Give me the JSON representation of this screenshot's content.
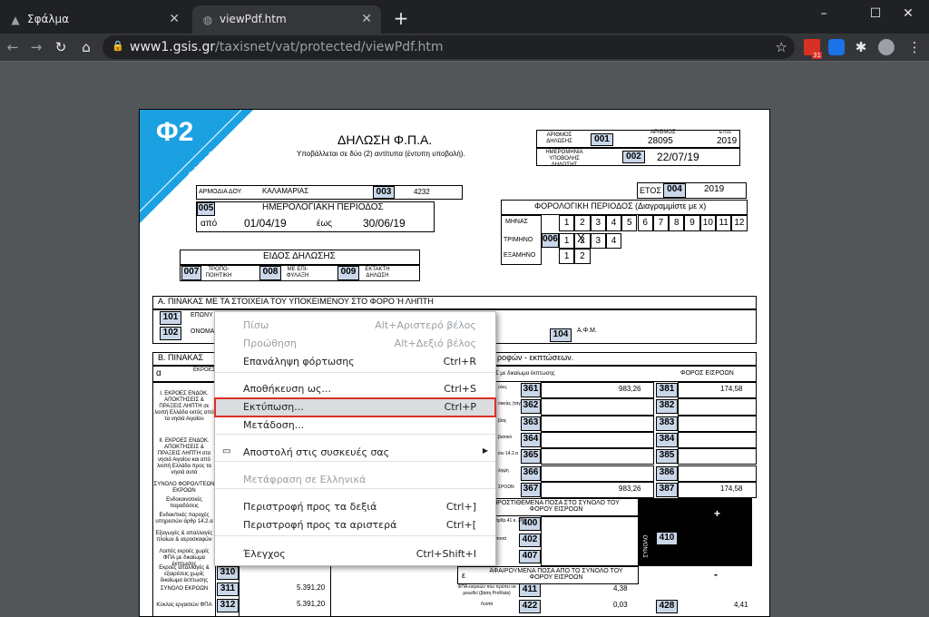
{
  "tabs": [
    {
      "title": "Σφάλμα",
      "active": false
    },
    {
      "title": "viewPdf.htm",
      "active": true
    }
  ],
  "window": {
    "minimize": "–",
    "maximize": "☐",
    "close": "✕"
  },
  "toolbar": {
    "url_host": "www1.gsis.gr",
    "url_path": "/taxisnet/vat/protected/viewPdf.htm"
  },
  "extensions": [
    "calendar-31",
    "cloud-extension",
    "puzzle-extensions",
    "profile-avatar"
  ],
  "colors": {
    "accent_blue": "#1ba1e2",
    "highlight_red": "#d93025",
    "code_fill": "#c9d7e8"
  },
  "form": {
    "logo": "Φ2",
    "logo_side": "TAXIS",
    "title": "ΔΗΛΩΣΗ Φ.Π.Α.",
    "subtitle": "Υποβάλλεται σε δύο (2) αντίτυπα (έντυπη υποβολή).",
    "arithmos_label": "ΑΡΙΘΜΟΣ ΔΗΛΩΣΗΣ",
    "code_001": "001",
    "arithmos_small": "ΑΡΙΘΜΟΣ",
    "arithmos_value": "28095",
    "etos_small": "ΕΤΟΣ",
    "arithmos_year": "2019",
    "hmerominia_label": "ΗΜΕΡΟΜΗΝΙΑ ΥΠΟΒΟΛΗΣ ΔΗΛΩΣΗΣ",
    "code_002": "002",
    "hmerominia_value": "22/07/19",
    "armodia_label": "ΑΡΜΟΔΙΑ ΔΟΥ",
    "armodia_value": "ΚΑΛΑΜΑΡΙΑΣ",
    "code_003": "003",
    "doy_code": "4232",
    "etos_label": "ΕΤΟΣ",
    "code_004": "004",
    "etos_value": "2019",
    "code_005": "005",
    "hmer_period_label": "ΗΜΕΡΟΛΟΓΙΑΚΗ ΠΕΡΙΟΔΟΣ",
    "apo_label": "από",
    "apo_value": "01/04/19",
    "eos_label": "έως",
    "eos_value": "30/06/19",
    "foro_period_label": "ΦΟΡΟΛΟΓΙΚΗ ΠΕΡΙΟΔΟΣ (Διαγραμμίστε με x)",
    "minas_label": "ΜΗΝΑΣ",
    "months": [
      "1",
      "2",
      "3",
      "4",
      "5",
      "6",
      "7",
      "8",
      "9",
      "10",
      "11",
      "12"
    ],
    "trimino_label": "ΤΡΙΜΗΝΟ",
    "code_006": "006",
    "quarters": [
      "1",
      "2",
      "3",
      "4"
    ],
    "quarter_mark": "X",
    "examino_label": "ΕΞΑΜΗΝΟ",
    "halves": [
      "1",
      "2"
    ],
    "eidos_label": "ΕΙΔΟΣ ΔΗΛΩΣΗΣ",
    "code_007": "007",
    "tropo_label": "ΤΡΟΠΟ- ΠΟΙΗΤΙΚΗ",
    "code_008": "008",
    "me_epi_label": "ΜΕ ΕΠΙ- ΦΥΛΑΞΗ",
    "code_009": "009",
    "ektakti_label": "ΕΚΤΑΚΤΗ ΔΗΛΩΣΗ",
    "section_a": "Α. ΠΙΝΑΚΑΣ ΜΕ ΤΑ ΣΤΟΙΧΕΙΑ ΤΟΥ ΥΠΟΚΕΙΜΕΝΟΥ ΣΤΟ ΦΟΡΟ Ή ΛΗΠΤΗ",
    "code_101": "101",
    "eponymo": "ΕΠΩΝΥ",
    "code_102": "102",
    "onoma": "ΟΝΟΜΑ",
    "code_104": "104",
    "afm_label": "Α.Φ.Μ.",
    "section_b": "Β. ΠΙΝΑΚΑΣ",
    "section_b_tail": "ροφών - εκπτώσεων.",
    "alpha": "α",
    "ekroes_header": "ΕΚΡΟΕΣ φορ υπηρεσιών κλπ",
    "ekroes_dik_header": "ΕΣ με δικαίωμα έκπτωσης",
    "foros_eisroon": "ΦΟΡΟΣ ΕΙΣΡΟΩΝ",
    "row_labels_left": [
      "I. ΕΚΡΟΕΣ ΕΝΔΟΚ. ΑΠΟΚΤΗΣΕΙΣ & ΠΡΑΞΕΙΣ ΛΗΠΤΗ σε λοιπή Ελλάδα εκτός από τα νησιά Αιγαίου",
      "II. ΕΚΡΟΕΣ ΕΝΔΟΚ. ΑΠΟΚΤΗΣΕΙΣ & ΠΡΑΞΕΙΣ ΛΗΠΤΗ στα νησιά Αιγαίου και από λοιπή Ελλάδα προς τα νησιά αυτά",
      "ΣΥΝΟΛΟ ΦΟΡΟΛ/ΤΕΩΝ ΕΚΡΟΩΝ",
      "Ενδοκοινοτικές παραδόσεις",
      "Ενδοκ/τικές παροχές υπηρεσιών άρθρ 14.2.α",
      "Εξαγωγές & απαλλαγές πλοίων & αεροσκαφών",
      "Λοιπές εκροές χωρίς ΦΠΑ με δικαίωμα έκπτωσης",
      "Εκροές απαλλαγές & εξαιρέσεις χωρίς δικαίωμα έκπτωσης",
      "ΣΥΝΟΛΟ ΕΚΡΟΩΝ",
      "Κύκλος εργασιών ΦΠΑ"
    ],
    "mid_labels": [
      "ύλες",
      "οικείες (ταγεί)",
      "βίας",
      "βιατικό",
      "ιου 14.2.α",
      "ληψη",
      "ΣΡΟΩΝ"
    ],
    "codes_mid": [
      "361",
      "362",
      "363",
      "364",
      "365",
      "366",
      "367"
    ],
    "mid_values": [
      "983,26",
      "",
      "",
      "",
      "",
      "",
      "983,26"
    ],
    "codes_right": [
      "381",
      "382",
      "383",
      "384",
      "385",
      "386",
      "387"
    ],
    "right_values": [
      "174,58",
      "",
      "",
      "",
      "",
      "",
      "174,58"
    ],
    "prostithemena": "ΠΡΟΣΤΙΘΕΜΕΝΑ ΠΟΣΑ ΣΤΟ ΣΥΝΟΛΟ ΤΟΥ ΦΟΡΟΥ ΕΙΣΡΟΩΝ",
    "codes_plus": [
      "400",
      "402",
      "407"
    ],
    "plus_labels": [
      "άρθρ.41 κ. 3%)",
      "ποσά",
      ""
    ],
    "code_410": "410",
    "synolo_side": "ΣΥΝΟΛΟ",
    "plus_sign": "+",
    "minus_sign": "-",
    "epsilon": "ε",
    "afairoumena": "ΑΦΑΙΡΟΥΜΕΝΑ ΠΟΣΑ ΑΠΟ ΤΟ ΣΥΝΟΛΟ ΤΟΥ ΦΟΡΟΥ ΕΙΣΡΟΩΝ",
    "code_411": "411",
    "code_411_label": "ΦΠΑ εισροών που πρέπει να μειωθεί (βάση ProRata)",
    "code_411_value": "4,38",
    "code_422": "422",
    "code_422_label": "Λοιπά",
    "code_422_value": "0,03",
    "code_428": "428",
    "code_428_value": "4,41",
    "codes_left": [
      "310",
      "311",
      "312"
    ],
    "left_values": [
      "",
      "5.391,20",
      "5.391,20"
    ]
  },
  "context_menu": {
    "items": [
      {
        "label": "Πίσω",
        "shortcut": "Alt+Αριστερό βέλος",
        "disabled": true
      },
      {
        "label": "Προώθηση",
        "shortcut": "Alt+Δεξιό βέλος",
        "disabled": true
      },
      {
        "label": "Επανάληψη φόρτωσης",
        "shortcut": "Ctrl+R",
        "disabled": false
      },
      {
        "label": "Αποθήκευση ως...",
        "shortcut": "Ctrl+S",
        "disabled": false
      },
      {
        "label": "Εκτύπωση...",
        "shortcut": "Ctrl+P",
        "disabled": false,
        "highlighted": true
      },
      {
        "label": "Μετάδοση...",
        "shortcut": "",
        "disabled": false
      },
      {
        "label": "Αποστολή στις συσκευές σας",
        "shortcut": "",
        "disabled": false,
        "submenu": true
      },
      {
        "label": "Μετάφραση σε Ελληνικά",
        "shortcut": "",
        "disabled": true
      },
      {
        "label": "Περιστροφή προς τα δεξιά",
        "shortcut": "Ctrl+]",
        "disabled": false
      },
      {
        "label": "Περιστροφή προς τα αριστερά",
        "shortcut": "Ctrl+[",
        "disabled": false
      },
      {
        "label": "Έλεγχος",
        "shortcut": "Ctrl+Shift+I",
        "disabled": false
      }
    ]
  }
}
